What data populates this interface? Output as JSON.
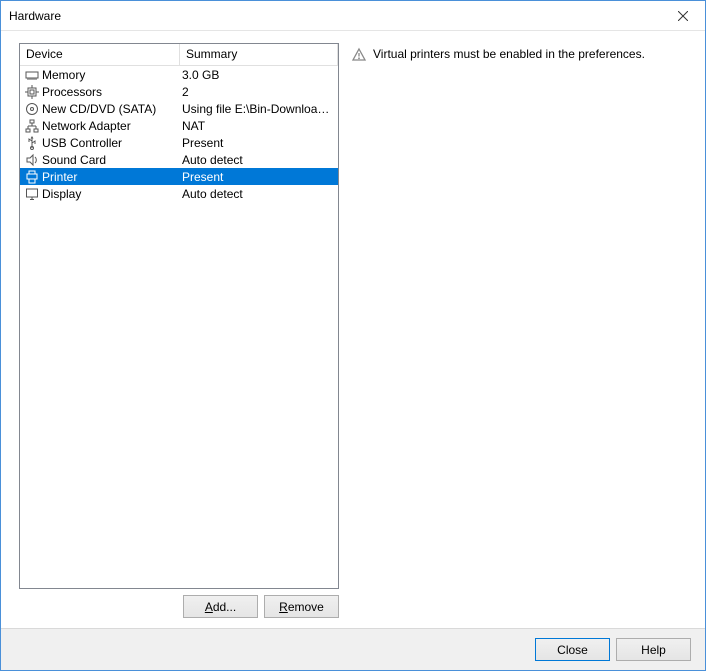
{
  "window": {
    "title": "Hardware"
  },
  "list": {
    "header_device": "Device",
    "header_summary": "Summary",
    "items": [
      {
        "icon": "memory-icon",
        "device": "Memory",
        "summary": "3.0 GB",
        "selected": false
      },
      {
        "icon": "cpu-icon",
        "device": "Processors",
        "summary": "2",
        "selected": false
      },
      {
        "icon": "cd-icon",
        "device": "New CD/DVD (SATA)",
        "summary": "Using file E:\\Bin-Downloads\\li...",
        "selected": false
      },
      {
        "icon": "network-icon",
        "device": "Network Adapter",
        "summary": "NAT",
        "selected": false
      },
      {
        "icon": "usb-icon",
        "device": "USB Controller",
        "summary": "Present",
        "selected": false
      },
      {
        "icon": "sound-icon",
        "device": "Sound Card",
        "summary": "Auto detect",
        "selected": false
      },
      {
        "icon": "printer-icon",
        "device": "Printer",
        "summary": "Present",
        "selected": true
      },
      {
        "icon": "display-icon",
        "device": "Display",
        "summary": "Auto detect",
        "selected": false
      }
    ]
  },
  "left_buttons": {
    "add": "Add...",
    "remove": "Remove"
  },
  "info": {
    "message": "Virtual printers must be enabled in the preferences."
  },
  "bottom": {
    "close": "Close",
    "help": "Help"
  }
}
